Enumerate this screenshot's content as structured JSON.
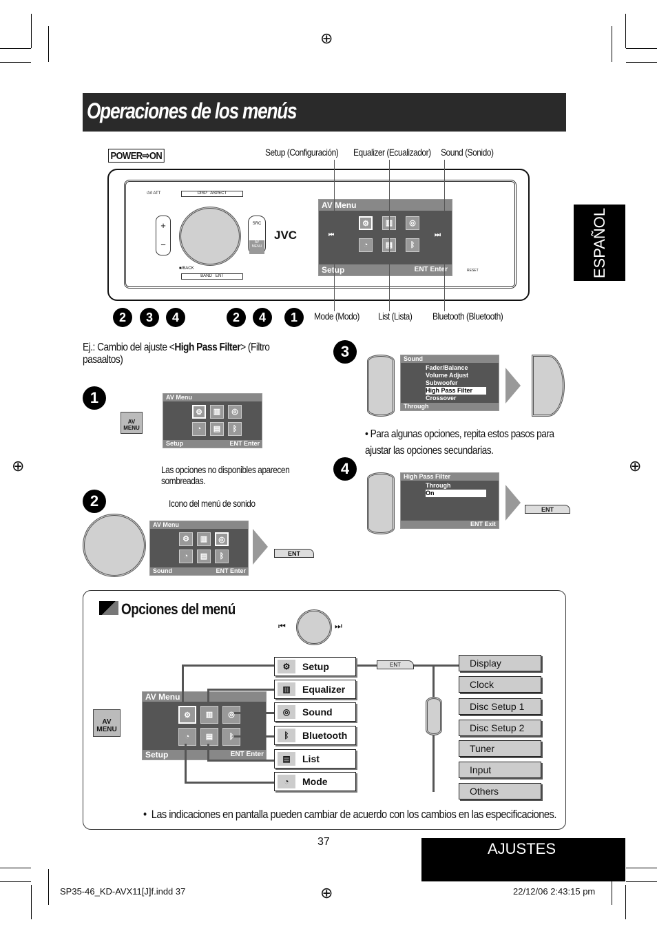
{
  "title": "Operaciones de los menús",
  "language_tab": "ESPAÑOL",
  "device": {
    "power_label": "POWER⇨ON",
    "callouts_top": [
      "Setup (Configuración)",
      "Equalizer (Ecualizador)",
      "Sound (Sonido)"
    ],
    "callouts_bottom": [
      "Mode (Modo)",
      "List (Lista)",
      "Bluetooth (Bluetooth)"
    ],
    "buttons": {
      "disp": "DISP",
      "aspect": "ASPECT",
      "att": "⏻/I ATT",
      "src": "SRC",
      "av_menu": "AV MENU",
      "band": "BAND",
      "ent": "ENT",
      "back": "■/BACK",
      "reset": "RESET",
      "brand": "JVC",
      "plus": "+",
      "minus": "−"
    },
    "screen": {
      "header": "AV Menu",
      "footer": "Setup",
      "ent": "ENT",
      "enter": "Enter"
    },
    "step_groups": [
      "2",
      "3",
      "4",
      "2",
      "4",
      "1"
    ]
  },
  "example": {
    "prefix": "Ej.: Cambio del ajuste <",
    "bold": "High Pass Filter",
    "suffix": "> (Filtro pasaaltos)"
  },
  "steps": {
    "s1": {
      "num": "1",
      "av_menu": "AV MENU",
      "screen_header": "AV Menu",
      "screen_footer": "Setup",
      "ent": "ENT",
      "enter": "Enter",
      "note": "Las opciones no disponibles aparecen sombreadas."
    },
    "s2": {
      "num": "2",
      "note": "Icono del menú de sonido",
      "screen_header": "AV Menu",
      "screen_footer": "Sound",
      "ent": "ENT",
      "enter": "Enter",
      "button": "ENT"
    },
    "s3": {
      "num": "3",
      "screen_header": "Sound",
      "items": [
        "Fader/Balance",
        "Volume Adjust",
        "Subwoofer",
        "High Pass Filter",
        "Crossover"
      ],
      "selected": "High Pass Filter",
      "screen_footer": "Through",
      "note": "Para algunas opciones, repita estos pasos para ajustar las opciones secundarias."
    },
    "s4": {
      "num": "4",
      "screen_header": "High Pass Filter",
      "items": [
        "Through",
        "On"
      ],
      "selected": "On",
      "ent": "ENT",
      "exit": "Exit",
      "button": "ENT"
    }
  },
  "options": {
    "heading": "Opciones del menú",
    "av_menu": "AV MENU",
    "screen": {
      "header": "AV Menu",
      "footer": "Setup",
      "ent": "ENT",
      "enter": "Enter"
    },
    "menu": [
      {
        "label": "Setup",
        "icon": "gear-icon"
      },
      {
        "label": "Equalizer",
        "icon": "equalizer-icon"
      },
      {
        "label": "Sound",
        "icon": "speaker-icon"
      },
      {
        "label": "Bluetooth",
        "icon": "bluetooth-icon"
      },
      {
        "label": "List",
        "icon": "list-icon"
      },
      {
        "label": "Mode",
        "icon": "mode-icon"
      }
    ],
    "ent": "ENT",
    "setup_items": [
      "Display",
      "Clock",
      "Disc Setup 1",
      "Disc Setup 2",
      "Tuner",
      "Input",
      "Others"
    ],
    "note": "Las indicaciones en pantalla pueden cambiar de acuerdo con los cambios en las especificaciones."
  },
  "page_number": "37",
  "section": "AJUSTES",
  "footer": {
    "file": "SP35-46_KD-AVX11[J]f.indd   37",
    "date": "22/12/06   2:43:15 pm"
  },
  "colors": {
    "title_bg": "#2a2a2a",
    "screen": "#555555",
    "black": "#000000"
  }
}
